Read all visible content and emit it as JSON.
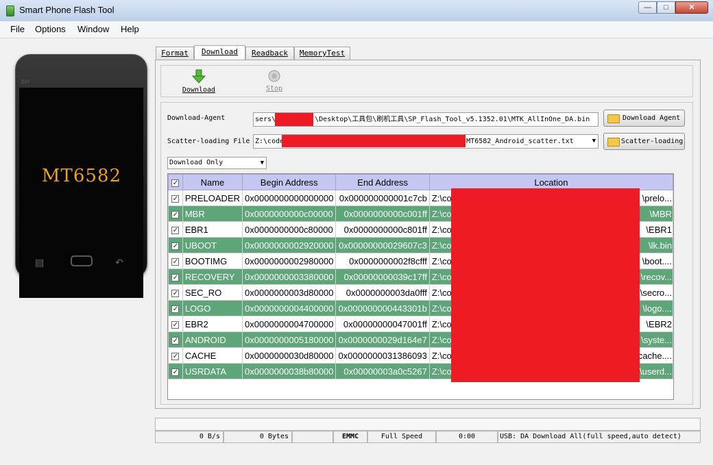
{
  "window": {
    "title": "Smart Phone Flash Tool"
  },
  "menu": [
    "File",
    "Options",
    "Window",
    "Help"
  ],
  "phone": {
    "brand": "BM",
    "chip": "MT6582"
  },
  "tabs": [
    "Format",
    "Download",
    "Readback",
    "MemoryTest"
  ],
  "active_tab": "Download",
  "toolbar": {
    "download_label": "Download",
    "stop_label": "Stop"
  },
  "download_agent": {
    "label": "Download-Agent",
    "path_prefix": "sers\\",
    "path_suffix": "\\Desktop\\工具包\\刷机工具\\SP_Flash_Tool_v5.1352.01\\MTK_AllInOne_DA.bin",
    "button": "Download Agent"
  },
  "scatter": {
    "label": "Scatter-loading File",
    "path_prefix": "Z:\\code",
    "path_suffix": "MT6582_Android_scatter.txt",
    "button": "Scatter-loading"
  },
  "mode": "Download Only",
  "table": {
    "headers": [
      "Name",
      "Begin Address",
      "End Address",
      "Location"
    ],
    "rows": [
      {
        "name": "PRELOADER",
        "begin": "0x0000000000000000",
        "end": "0x000000000001c7cb",
        "loc_start": "Z:\\code",
        "loc_end": "\\prelo..."
      },
      {
        "name": "MBR",
        "begin": "0x0000000000c00000",
        "end": "0x0000000000c001ff",
        "loc_start": "Z:\\code",
        "loc_end": "\\MBR"
      },
      {
        "name": "EBR1",
        "begin": "0x0000000000c80000",
        "end": "0x0000000000c801ff",
        "loc_start": "Z:\\code",
        "loc_end": "\\EBR1"
      },
      {
        "name": "UBOOT",
        "begin": "0x0000000002920000",
        "end": "0x00000000029607c3",
        "loc_start": "Z:\\code",
        "loc_end": "\\lk.bin"
      },
      {
        "name": "BOOTIMG",
        "begin": "0x0000000002980000",
        "end": "0x0000000002f8cfff",
        "loc_start": "Z:\\code",
        "loc_end": "\\boot...."
      },
      {
        "name": "RECOVERY",
        "begin": "0x0000000003380000",
        "end": "0x00000000039c17ff",
        "loc_start": "Z:\\code",
        "loc_end": "\\recov..."
      },
      {
        "name": "SEC_RO",
        "begin": "0x0000000003d80000",
        "end": "0x0000000003da0fff",
        "loc_start": "Z:\\code",
        "loc_end": "\\secro..."
      },
      {
        "name": "LOGO",
        "begin": "0x0000000004400000",
        "end": "0x000000000443301b",
        "loc_start": "Z:\\code",
        "loc_end": "\\logo...."
      },
      {
        "name": "EBR2",
        "begin": "0x0000000004700000",
        "end": "0x00000000047001ff",
        "loc_start": "Z:\\code",
        "loc_end": "\\EBR2"
      },
      {
        "name": "ANDROID",
        "begin": "0x0000000005180000",
        "end": "0x0000000029d164e7",
        "loc_start": "Z:\\code",
        "loc_end": "\\syste..."
      },
      {
        "name": "CACHE",
        "begin": "0x0000000030d80000",
        "end": "0x0000000031386093",
        "loc_start": "Z:\\code",
        "loc_end": "\\cache...."
      },
      {
        "name": "USRDATA",
        "begin": "0x0000000038b80000",
        "end": "0x00000003a0c5267",
        "loc_start": "Z:\\code",
        "loc_end": "\\userd..."
      }
    ]
  },
  "status": {
    "speed": "0 B/s",
    "bytes": "0 Bytes",
    "storage": "EMMC",
    "speed_mode": "Full Speed",
    "time": "0:00",
    "usb": "USB: DA Download All(full speed,auto detect)"
  },
  "colors": {
    "row_alt": "#5ea67a",
    "header": "#c6c6f2",
    "redaction": "#ed1c24",
    "chip_label": "#e8a028"
  }
}
